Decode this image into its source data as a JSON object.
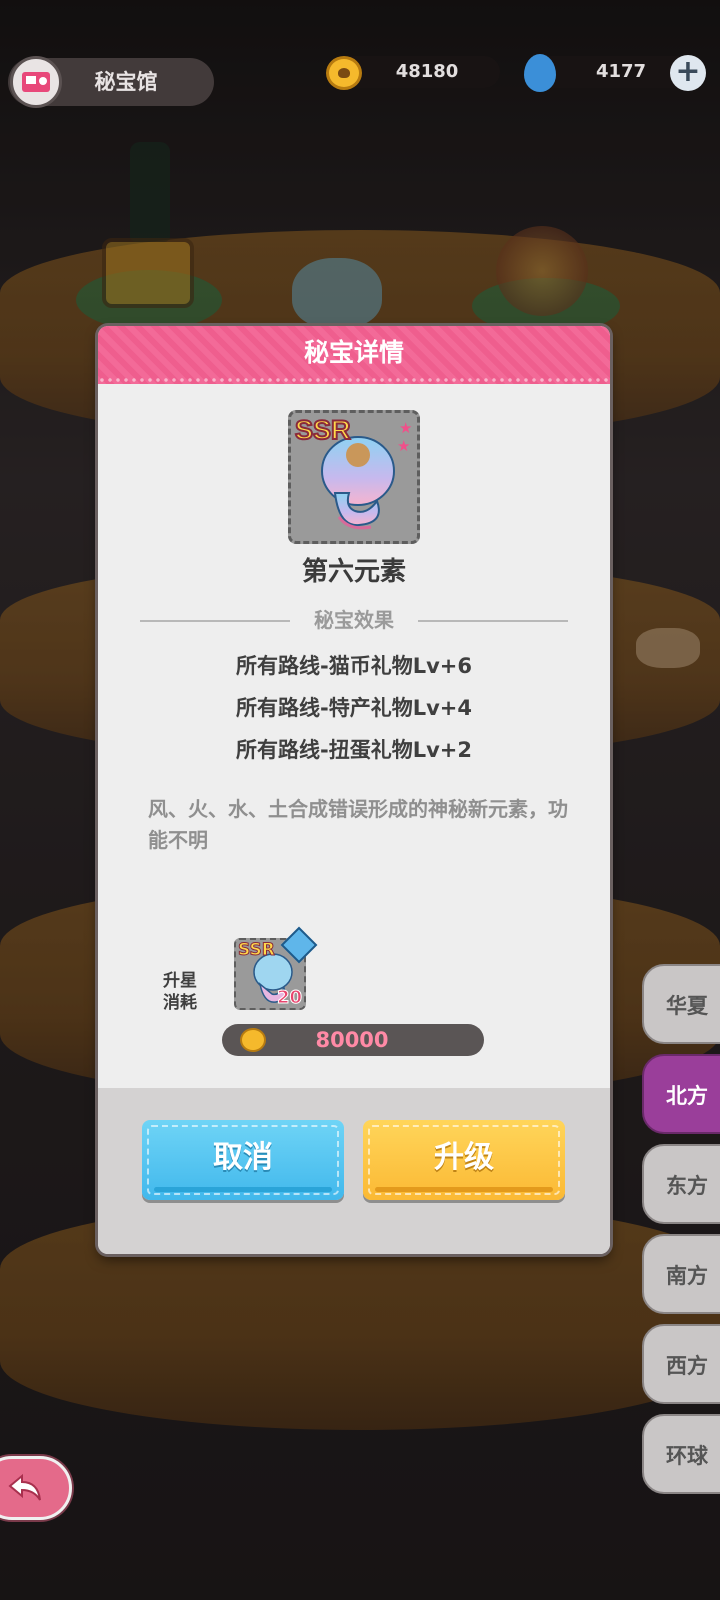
{
  "header": {
    "title": "秘宝馆",
    "coins": "48180",
    "gems": "4177",
    "add_label": "+"
  },
  "modal": {
    "title": "秘宝详情",
    "rarity": "SSR",
    "item_name": "第六元素",
    "section_title": "秘宝效果",
    "effects": [
      "所有路线-猫币礼物Lv+6",
      "所有路线-特产礼物Lv+4",
      "所有路线-扭蛋礼物Lv+2"
    ],
    "description": "风、火、水、土合成错误形成的神秘新元素，功能不明",
    "upgrade_cost": {
      "label_line1": "升星",
      "label_line2": "消耗",
      "rarity": "SSR",
      "item_count": "20",
      "coin_amount": "80000"
    },
    "buttons": {
      "cancel": "取消",
      "upgrade": "升级"
    }
  },
  "regions": [
    {
      "label": "华夏",
      "active": false
    },
    {
      "label": "北方",
      "active": true
    },
    {
      "label": "东方",
      "active": false
    },
    {
      "label": "南方",
      "active": false
    },
    {
      "label": "西方",
      "active": false
    },
    {
      "label": "环球",
      "active": false
    }
  ],
  "colors": {
    "header_pink": "#f36a98",
    "cancel_blue": "#41b8ec",
    "upgrade_yellow": "#fbb934",
    "active_region": "#9a3e9a",
    "cost_text": "#ff8aa6"
  },
  "icons": {
    "title": "treasure-room-icon",
    "coin": "paw-coin-icon",
    "gem": "blue-drop-gem-icon",
    "back": "back-arrow-icon"
  }
}
